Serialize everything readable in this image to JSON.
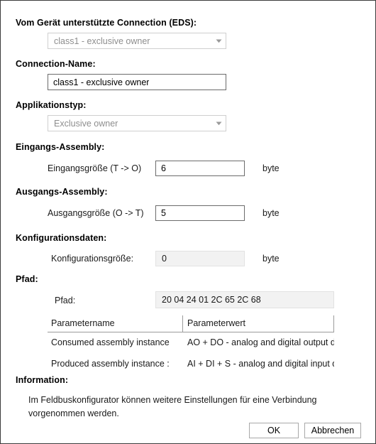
{
  "dialog": {
    "sections": {
      "supported_connection": "Vom Gerät unterstützte Connection (EDS):",
      "connection_name": "Connection-Name:",
      "application_type": "Applikationstyp:",
      "input_assembly": "Eingangs-Assembly:",
      "output_assembly": "Ausgangs-Assembly:",
      "configuration_data": "Konfigurationsdaten:",
      "path": "Pfad:",
      "information": "Information:"
    },
    "supported_connection": {
      "value": "class1 - exclusive owner",
      "icon": "chevron-down-icon"
    },
    "connection_name": {
      "value": "class1 - exclusive owner"
    },
    "application_type": {
      "value": "Exclusive owner",
      "icon": "chevron-down-icon"
    },
    "input_size": {
      "label": "Eingangsgröße (T -> O)",
      "value": "6",
      "unit": "byte"
    },
    "output_size": {
      "label": "Ausgangsgröße (O -> T)",
      "value": "5",
      "unit": "byte"
    },
    "config_size": {
      "label": "Konfigurationsgröße:",
      "value": "0",
      "unit": "byte"
    },
    "path_field": {
      "label": "Pfad:",
      "value": "20 04 24 01 2C 65 2C 68"
    },
    "parameter_grid": {
      "columns": [
        "Parametername",
        "Parameterwert"
      ],
      "rows": [
        {
          "name": "Consumed assembly instance",
          "value": "AO + DO - analog and digital output data"
        },
        {
          "name": "Produced assembly instance :",
          "value": "AI + DI + S - analog and digital input data plus sta"
        }
      ]
    },
    "information": {
      "text": "Im Feldbuskonfigurator können weitere Einstellungen für eine Verbindung vorgenommen werden."
    },
    "buttons": {
      "ok": "OK",
      "cancel": "Abbrechen"
    }
  }
}
